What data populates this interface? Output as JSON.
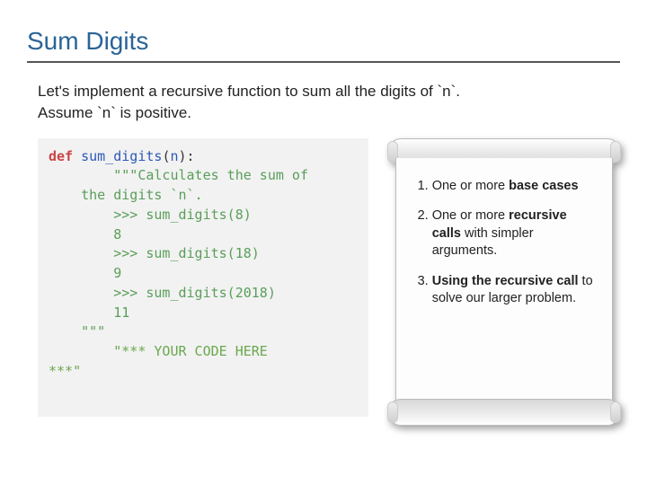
{
  "title": "Sum Digits",
  "intro_1": "Let's implement a recursive function to sum all the digits of `n`.",
  "intro_2": "Assume `n` is positive.",
  "code": {
    "kw_def": "def",
    "fn_name": "sum_digits",
    "param": "n",
    "doc_open": "\"\"\"",
    "doc_line1": "Calculates the sum of",
    "doc_line2": "the digits `n`.",
    "ex1_in": ">>> sum_digits(8)",
    "ex1_out": "8",
    "ex2_in": ">>> sum_digits(18)",
    "ex2_out": "9",
    "ex3_in": ">>> sum_digits(2018)",
    "ex3_out": "11",
    "doc_close": "\"\"\"",
    "placeholder_a": "\"*** YOUR CODE HERE",
    "placeholder_b": "***\""
  },
  "steps": {
    "s1_a": "One or more ",
    "s1_b": "base cases",
    "s2_a": "One or more ",
    "s2_b": "recursive calls",
    "s2_c": " with simpler arguments.",
    "s3_a": "Using the recursive call",
    "s3_b": " to solve our larger problem."
  }
}
